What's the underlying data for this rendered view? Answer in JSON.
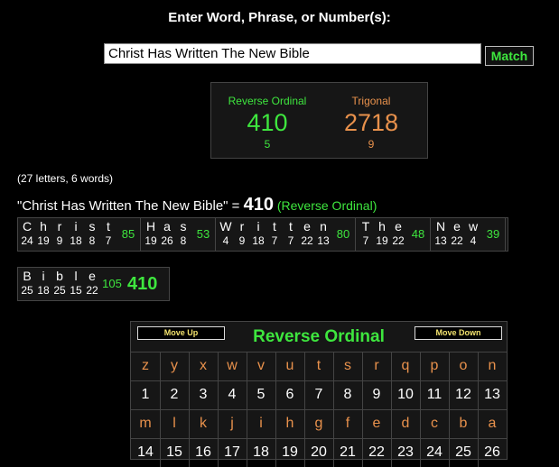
{
  "prompt": "Enter Word, Phrase, or Number(s):",
  "input": {
    "value": "Christ Has Written The New Bible"
  },
  "match_label": "Match",
  "summary": [
    {
      "name": "Reverse Ordinal",
      "value": "410",
      "reduction": "5",
      "color": "#3ee63e"
    },
    {
      "name": "Trigonal",
      "value": "2718",
      "reduction": "9",
      "color": "#e8914c"
    }
  ],
  "letter_count": "(27 letters, 6 words)",
  "result": {
    "phrase": "\"Christ Has Written The New Bible\" = ",
    "total": "410",
    "cipher": " (Reverse Ordinal)"
  },
  "breakdown": {
    "rows": [
      [
        {
          "letters": [
            "C",
            "h",
            "r",
            "i",
            "s",
            "t"
          ],
          "values": [
            "24",
            "19",
            "9",
            "18",
            "8",
            "7"
          ],
          "sum": "85"
        },
        {
          "letters": [
            "H",
            "a",
            "s"
          ],
          "values": [
            "19",
            "26",
            "8"
          ],
          "sum": "53"
        },
        {
          "letters": [
            "W",
            "r",
            "i",
            "t",
            "t",
            "e",
            "n"
          ],
          "values": [
            "4",
            "9",
            "18",
            "7",
            "7",
            "22",
            "13"
          ],
          "sum": "80"
        },
        {
          "letters": [
            "T",
            "h",
            "e"
          ],
          "values": [
            "7",
            "19",
            "22"
          ],
          "sum": "48"
        },
        {
          "letters": [
            "N",
            "e",
            "w"
          ],
          "values": [
            "13",
            "22",
            "4"
          ],
          "sum": "39"
        }
      ],
      [
        {
          "letters": [
            "B",
            "i",
            "b",
            "l",
            "e"
          ],
          "values": [
            "25",
            "18",
            "25",
            "15",
            "22"
          ],
          "sum": "105"
        }
      ]
    ],
    "total": "410"
  },
  "cipher_table": {
    "title": "Reverse Ordinal",
    "move_up": "Move Up",
    "move_down": "Move Down",
    "row1_letters": [
      "z",
      "y",
      "x",
      "w",
      "v",
      "u",
      "t",
      "s",
      "r",
      "q",
      "p",
      "o",
      "n"
    ],
    "row1_values": [
      "1",
      "2",
      "3",
      "4",
      "5",
      "6",
      "7",
      "8",
      "9",
      "10",
      "11",
      "12",
      "13"
    ],
    "row2_letters": [
      "m",
      "l",
      "k",
      "j",
      "i",
      "h",
      "g",
      "f",
      "e",
      "d",
      "c",
      "b",
      "a"
    ],
    "row2_values": [
      "14",
      "15",
      "16",
      "17",
      "18",
      "19",
      "20",
      "21",
      "22",
      "23",
      "24",
      "25",
      "26"
    ]
  }
}
